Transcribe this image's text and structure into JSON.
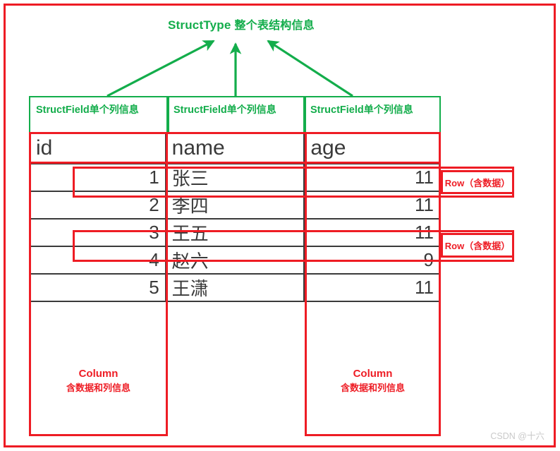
{
  "title": {
    "en": "StructType",
    "zh": "整个表结构信息"
  },
  "colors": {
    "green": "#13ad4b",
    "red": "#ee1c24",
    "table_border": "#3a3a3a",
    "watermark": "#c9c9c9"
  },
  "structfields": [
    {
      "en": "StructField",
      "zh": "单个列信息"
    },
    {
      "en": "StructField",
      "zh": "单个列信息"
    },
    {
      "en": "StructField",
      "zh": "单个列信息"
    }
  ],
  "table": {
    "headers": [
      "id",
      "name",
      "age"
    ],
    "rows": [
      [
        "1",
        "张三",
        "11"
      ],
      [
        "2",
        "李四",
        "11"
      ],
      [
        "3",
        "王五",
        "11"
      ],
      [
        "4",
        "赵六",
        "9"
      ],
      [
        "5",
        "王潇",
        "11"
      ]
    ]
  },
  "row_callouts": [
    {
      "label": "Row（含数据）"
    },
    {
      "label": "Row（含数据）"
    }
  ],
  "column_callouts": [
    {
      "t1": "Column",
      "t2": "含数据和列信息"
    },
    {
      "t1": "Column",
      "t2": "含数据和列信息"
    }
  ],
  "watermark": "CSDN @十六"
}
